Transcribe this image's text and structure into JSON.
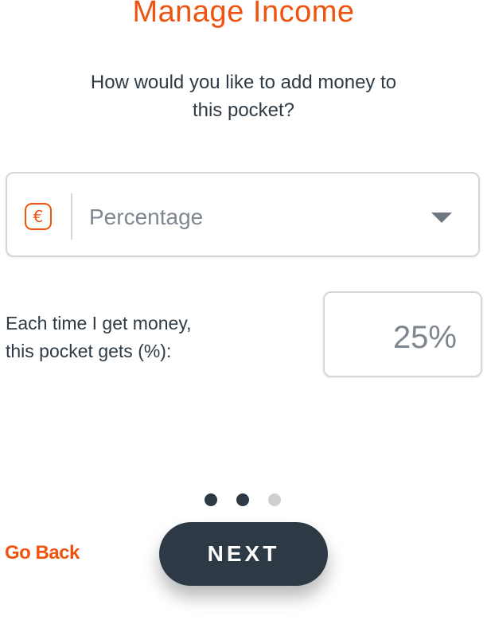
{
  "header": {
    "title": "Manage Income"
  },
  "question": {
    "line1": "How would you like to add money to",
    "line2": "this pocket?"
  },
  "method_select": {
    "icon": "euro-icon",
    "icon_glyph": "€",
    "selected_value": "Percentage",
    "caret_icon": "chevron-down-icon"
  },
  "allocation": {
    "label_line1": "Each time I get money,",
    "label_line2": "this pocket gets (%):",
    "value": "25%"
  },
  "pagination": {
    "total": 3,
    "current": 2,
    "active_color": "#2d3a45",
    "inactive_color": "#cfcfcf"
  },
  "footer": {
    "back_label": "Go Back",
    "next_label": "NEXT"
  },
  "colors": {
    "accent": "#f0530f",
    "primary_dark": "#2d3a45",
    "border": "#d6d6d6",
    "muted_text": "#7e8690"
  }
}
